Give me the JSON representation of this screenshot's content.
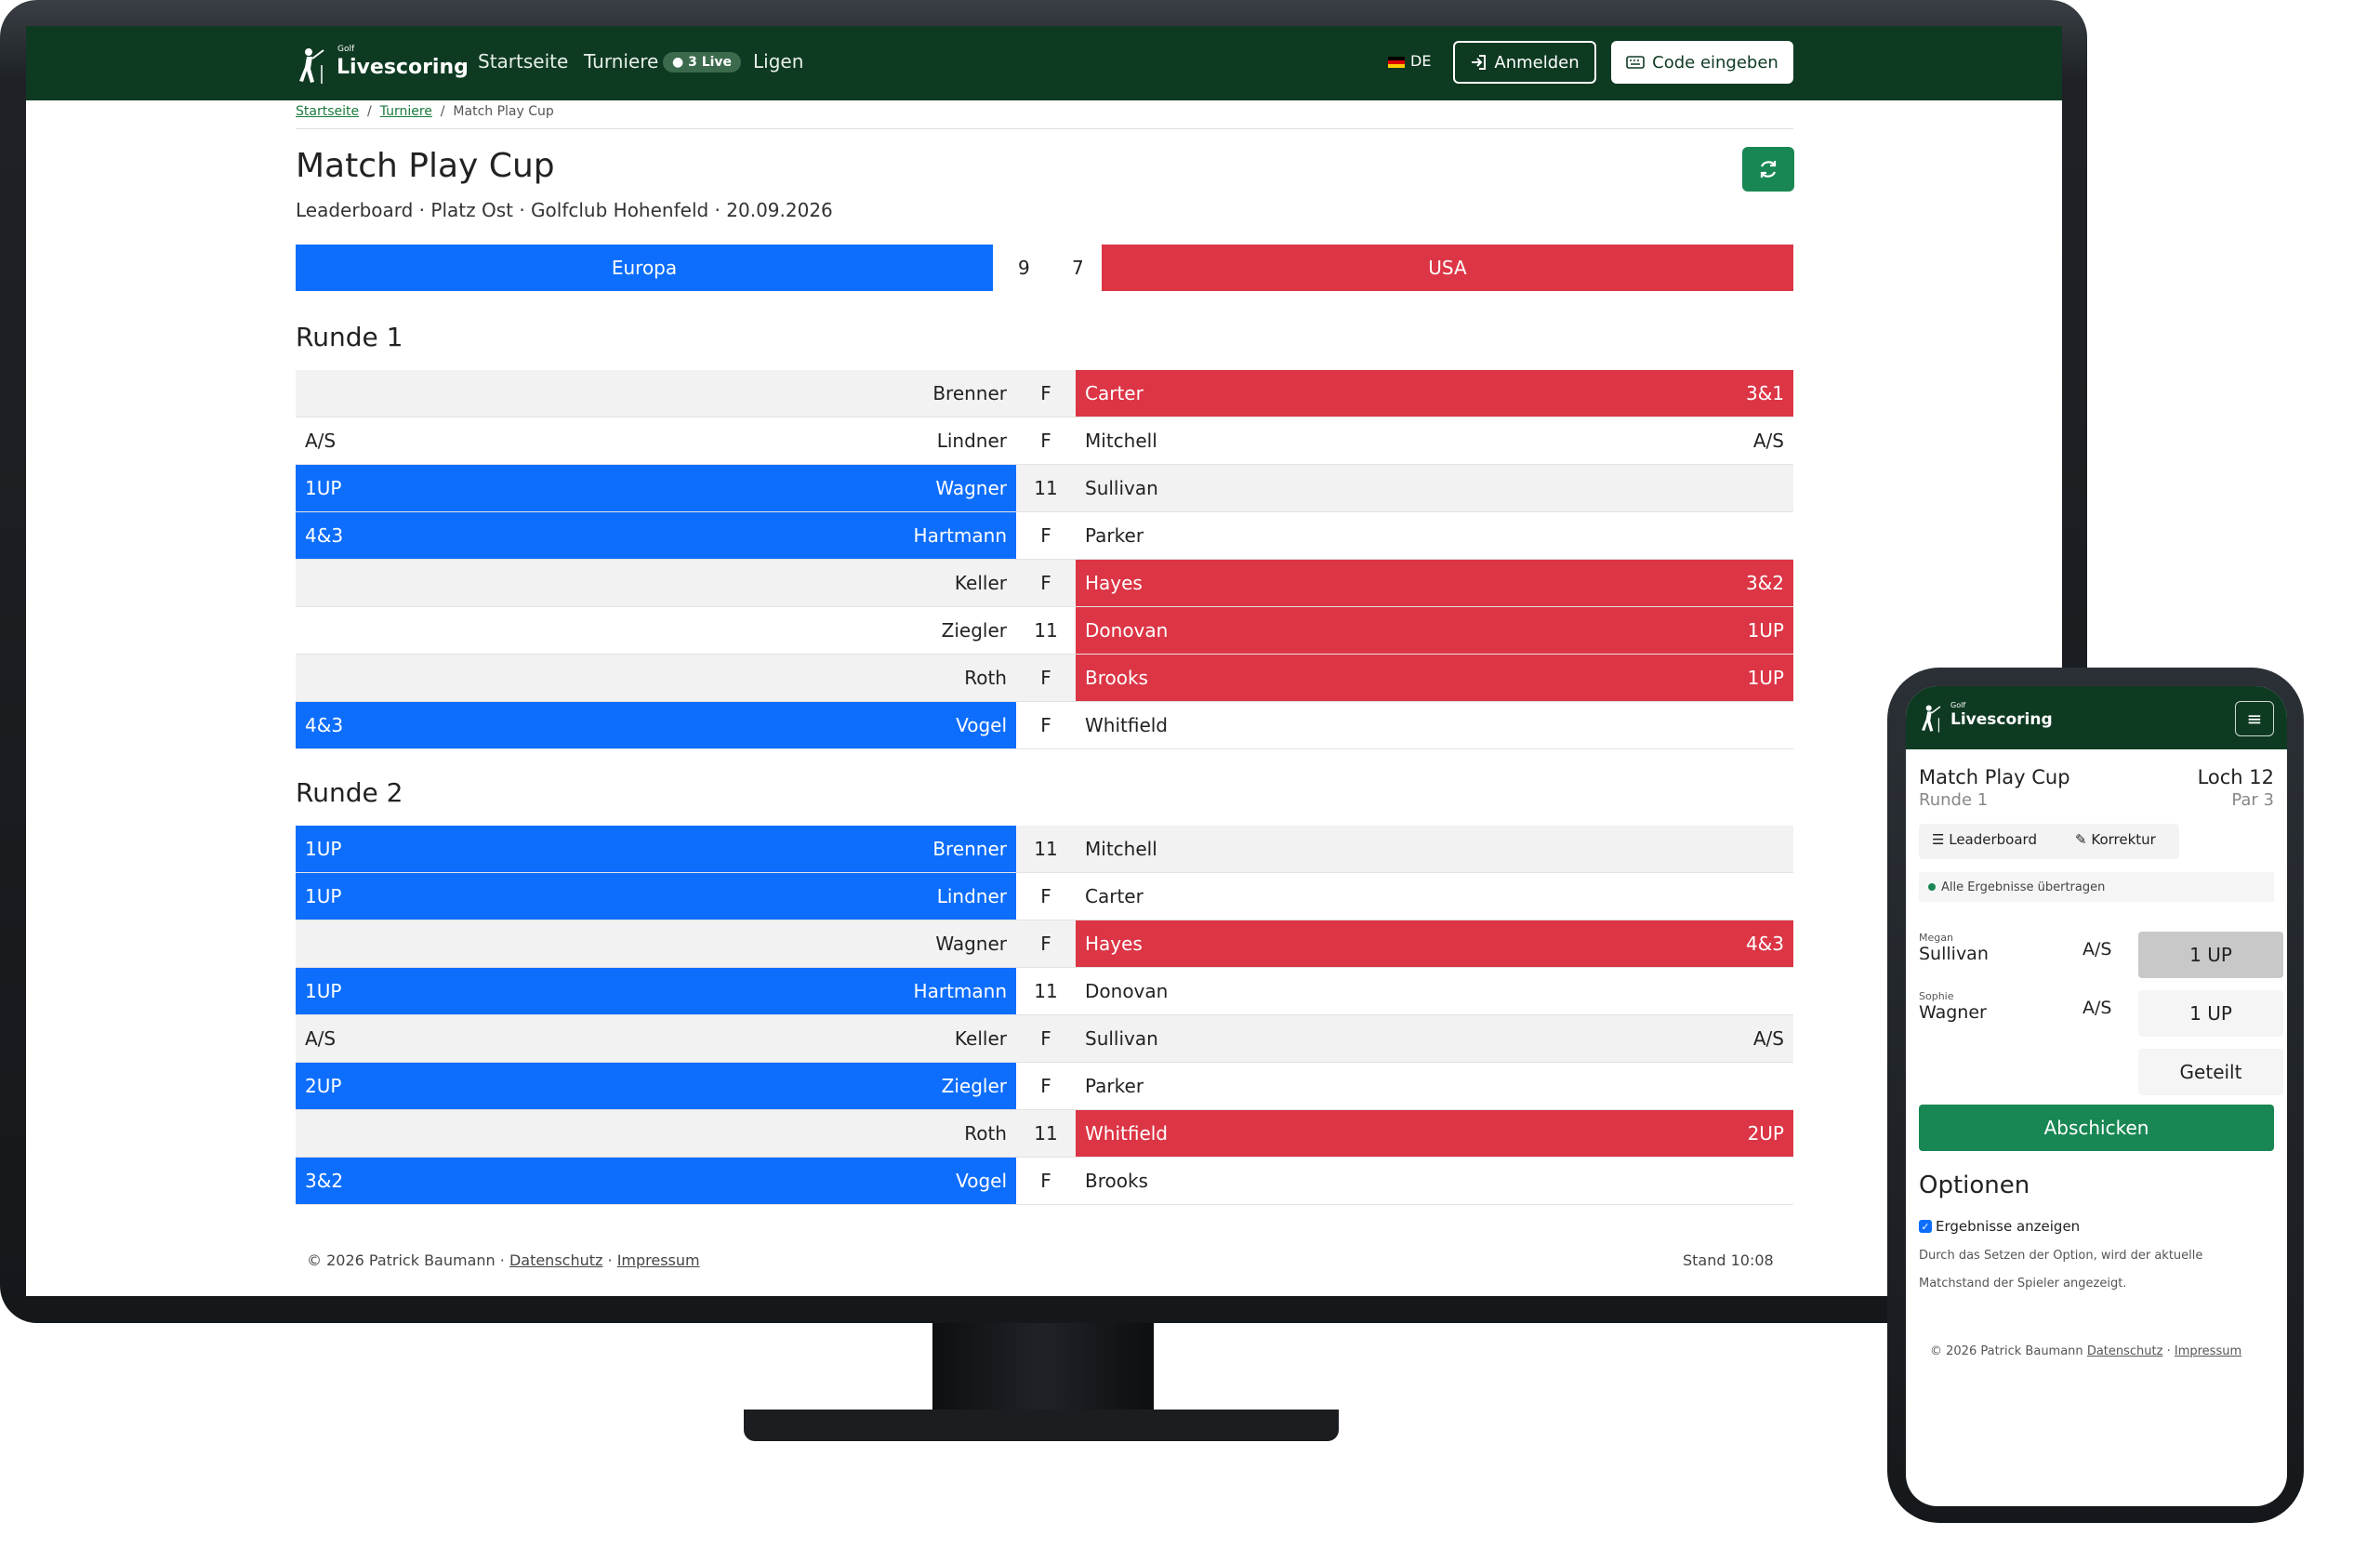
{
  "app": {
    "brand_small": "Golf",
    "brand_name": "Livescoring"
  },
  "nav": {
    "home": "Startseite",
    "tournaments": "Turniere",
    "live_badge": "3 Live",
    "leagues": "Ligen",
    "lang": "DE",
    "login": "Anmelden",
    "code": "Code eingeben"
  },
  "breadcrumb": {
    "home": "Startseite",
    "sep1": "/",
    "tournaments": "Turniere",
    "sep2": "/",
    "current": "Match Play Cup"
  },
  "page": {
    "title": "Match Play Cup",
    "subtitle": "Leaderboard · Platz Ost · Golfclub Hohenfeld · 20.09.2026"
  },
  "teams": {
    "left": "Europa",
    "left_score": "9",
    "right_score": "7",
    "right": "USA"
  },
  "round1": {
    "title": "Runde 1",
    "rows": [
      {
        "lres": "",
        "lname": "Brenner",
        "lwin": false,
        "mid": "F",
        "rname": "Carter",
        "rres": "3&1",
        "rwin": true
      },
      {
        "lres": "A/S",
        "lname": "Lindner",
        "lwin": false,
        "mid": "F",
        "rname": "Mitchell",
        "rres": "A/S",
        "rwin": false
      },
      {
        "lres": "1UP",
        "lname": "Wagner",
        "lwin": true,
        "mid": "11",
        "rname": "Sullivan",
        "rres": "",
        "rwin": false
      },
      {
        "lres": "4&3",
        "lname": "Hartmann",
        "lwin": true,
        "mid": "F",
        "rname": "Parker",
        "rres": "",
        "rwin": false
      },
      {
        "lres": "",
        "lname": "Keller",
        "lwin": false,
        "mid": "F",
        "rname": "Hayes",
        "rres": "3&2",
        "rwin": true
      },
      {
        "lres": "",
        "lname": "Ziegler",
        "lwin": false,
        "mid": "11",
        "rname": "Donovan",
        "rres": "1UP",
        "rwin": true
      },
      {
        "lres": "",
        "lname": "Roth",
        "lwin": false,
        "mid": "F",
        "rname": "Brooks",
        "rres": "1UP",
        "rwin": true
      },
      {
        "lres": "4&3",
        "lname": "Vogel",
        "lwin": true,
        "mid": "F",
        "rname": "Whitfield",
        "rres": "",
        "rwin": false
      }
    ]
  },
  "round2": {
    "title": "Runde 2",
    "rows": [
      {
        "lres": "1UP",
        "lname": "Brenner",
        "lwin": true,
        "mid": "11",
        "rname": "Mitchell",
        "rres": "",
        "rwin": false
      },
      {
        "lres": "1UP",
        "lname": "Lindner",
        "lwin": true,
        "mid": "F",
        "rname": "Carter",
        "rres": "",
        "rwin": false
      },
      {
        "lres": "",
        "lname": "Wagner",
        "lwin": false,
        "mid": "F",
        "rname": "Hayes",
        "rres": "4&3",
        "rwin": true
      },
      {
        "lres": "1UP",
        "lname": "Hartmann",
        "lwin": true,
        "mid": "11",
        "rname": "Donovan",
        "rres": "",
        "rwin": false
      },
      {
        "lres": "A/S",
        "lname": "Keller",
        "lwin": false,
        "mid": "F",
        "rname": "Sullivan",
        "rres": "A/S",
        "rwin": false
      },
      {
        "lres": "2UP",
        "lname": "Ziegler",
        "lwin": true,
        "mid": "F",
        "rname": "Parker",
        "rres": "",
        "rwin": false
      },
      {
        "lres": "",
        "lname": "Roth",
        "lwin": false,
        "mid": "11",
        "rname": "Whitfield",
        "rres": "2UP",
        "rwin": true
      },
      {
        "lres": "3&2",
        "lname": "Vogel",
        "lwin": true,
        "mid": "F",
        "rname": "Brooks",
        "rres": "",
        "rwin": false
      }
    ]
  },
  "footer": {
    "copy": "© 2026 Patrick Baumann ·",
    "privacy": "Datenschutz",
    "dot": "·",
    "imprint": "Impressum",
    "stand": "Stand 10:08"
  },
  "phone": {
    "brand_small": "Golf",
    "brand_name": "Livescoring",
    "title": "Match Play Cup",
    "round": "Runde 1",
    "hole": "Loch 12",
    "par": "Par 3",
    "tab_leaderboard": "Leaderboard",
    "tab_correction": "Korrektur",
    "status": "Alle Ergebnisse übertragen",
    "p1_first": "Megan",
    "p1_last": "Sullivan",
    "p1_state": "A/S",
    "p1_btn": "1 UP",
    "p2_first": "Sophie",
    "p2_last": "Wagner",
    "p2_state": "A/S",
    "p2_btn": "1 UP",
    "halved": "Geteilt",
    "submit": "Abschicken",
    "options_title": "Optionen",
    "option_label": "Ergebnisse anzeigen",
    "option_desc": "Durch das Setzen der Option, wird der aktuelle Matchstand der Spieler angezeigt.",
    "footer_copy": "© 2026 Patrick Baumann",
    "footer_privacy": "Datenschutz",
    "footer_dot": "·",
    "footer_imprint": "Impressum"
  },
  "colors": {
    "nav": "#0e3a22",
    "europe": "#0d6efd",
    "usa": "#dc3545",
    "accent": "#198754"
  }
}
